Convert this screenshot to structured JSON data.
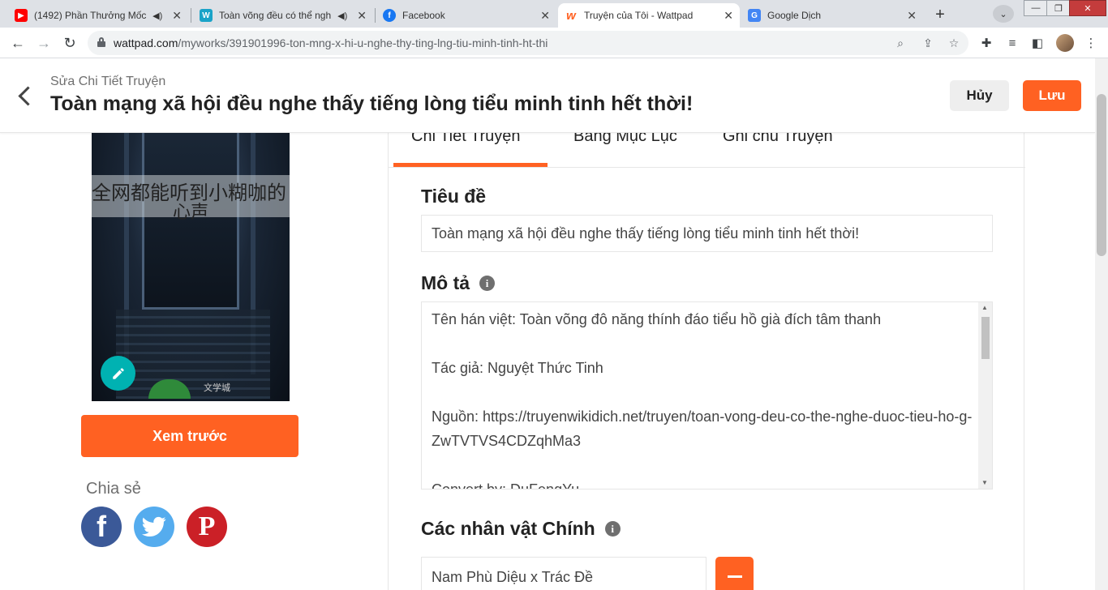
{
  "browser": {
    "tabs": [
      {
        "title": "(1492) Phần Thưởng Mốc",
        "icon": "youtube-icon",
        "color": "#ff0000",
        "audio": true
      },
      {
        "title": "Toàn võng đều có thể ngh",
        "icon": "wikidich-icon",
        "color": "#1aa3c8",
        "audio": true
      },
      {
        "title": "Facebook",
        "icon": "facebook-icon",
        "color": "#1877f2",
        "audio": false
      },
      {
        "title": "Truyện của Tôi - Wattpad",
        "icon": "wattpad-icon",
        "color": "#ff6122",
        "audio": false
      },
      {
        "title": "Google Dịch",
        "icon": "google-translate-icon",
        "color": "#4285f4",
        "audio": false
      }
    ],
    "url_host": "wattpad.com",
    "url_path": "/myworks/391901996-ton-mng-x-hi-u-nghe-thy-ting-lng-tiu-minh-tinh-ht-thi"
  },
  "header": {
    "subtitle": "Sửa Chi Tiết Truyện",
    "title": "Toàn mạng xã hội đều nghe thấy tiếng lòng tiểu minh tinh hết thời!",
    "cancel_label": "Hủy",
    "save_label": "Lưu"
  },
  "cover": {
    "title_line1": "全网都能听到小糊咖的",
    "title_line2": "心声",
    "publisher": "文学城"
  },
  "sidebar": {
    "preview_label": "Xem trước",
    "share_label": "Chia sẻ"
  },
  "tabs": [
    "Chi Tiết Truyện",
    "Bảng Mục Lục",
    "Ghi chú Truyện"
  ],
  "form": {
    "title_label": "Tiêu đề",
    "title_value": "Toàn mạng xã hội đều nghe thấy tiếng lòng tiểu minh tinh hết thời!",
    "description_label": "Mô tả",
    "description_lines": [
      "Tên hán việt: Toàn võng đô năng thính đáo tiểu hồ già đích tâm thanh",
      "",
      "Tác giả: Nguyệt Thức Tinh",
      "",
      "Nguồn: https://truyenwikidich.net/truyen/toan-vong-deu-co-the-nghe-duoc-tieu-ho-g-ZwTVTVS4CDZqhMa3",
      "",
      "Convert by: DuFengYu"
    ],
    "characters_label": "Các nhân vật Chính",
    "character_value": "Nam Phù Diệu x Trác Đề"
  },
  "colors": {
    "accent": "#ff6122",
    "teal": "#00b2b2",
    "facebook": "#3b5998",
    "twitter": "#55acee",
    "pinterest": "#cb2027"
  }
}
